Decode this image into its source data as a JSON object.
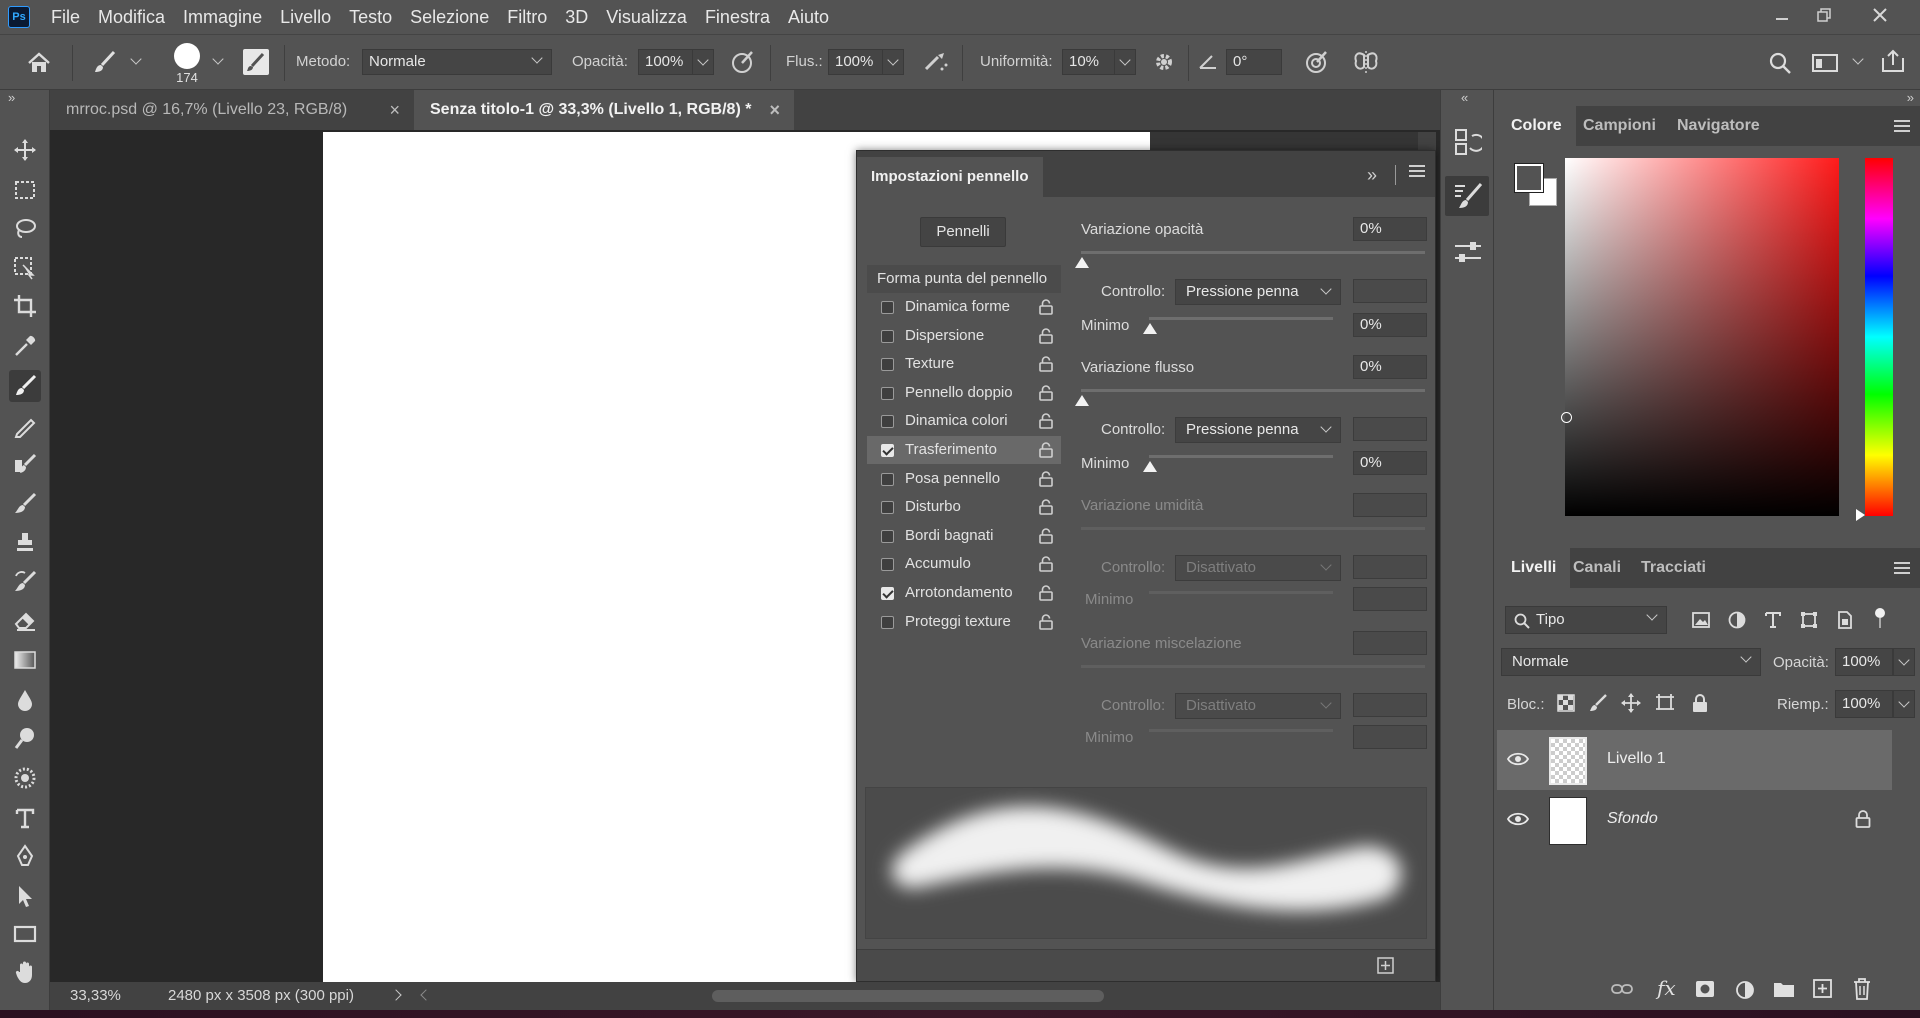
{
  "menubar": {
    "logo": "Ps",
    "items": [
      "File",
      "Modifica",
      "Immagine",
      "Livello",
      "Testo",
      "Selezione",
      "Filtro",
      "3D",
      "Visualizza",
      "Finestra",
      "Aiuto"
    ]
  },
  "options": {
    "brush_size": "174",
    "mode_label": "Metodo:",
    "mode_value": "Normale",
    "opacity_label": "Opacità:",
    "opacity_value": "100%",
    "flow_label": "Flus.:",
    "flow_value": "100%",
    "smoothing_label": "Uniformità:",
    "smoothing_value": "10%",
    "angle_value": "0°"
  },
  "tabs": [
    {
      "label": "mrroc.psd @ 16,7% (Livello 23, RGB/8)",
      "close": "×"
    },
    {
      "label": "Senza titolo-1 @ 33,3% (Livello 1, RGB/8) *",
      "close": "×"
    }
  ],
  "brush_panel": {
    "title": "Impostazioni pennello",
    "brushes_button": "Pennelli",
    "tip_shape": "Forma punta del pennello",
    "items": [
      {
        "label": "Dinamica forme",
        "checked": false
      },
      {
        "label": "Dispersione",
        "checked": false
      },
      {
        "label": "Texture",
        "checked": false
      },
      {
        "label": "Pennello doppio",
        "checked": false
      },
      {
        "label": "Dinamica colori",
        "checked": false
      },
      {
        "label": "Trasferimento",
        "checked": true
      },
      {
        "label": "Posa pennello",
        "checked": false
      },
      {
        "label": "Disturbo",
        "checked": false
      },
      {
        "label": "Bordi bagnati",
        "checked": false
      },
      {
        "label": "Accumulo",
        "checked": false
      },
      {
        "label": "Arrotondamento",
        "checked": true
      },
      {
        "label": "Proteggi texture",
        "checked": false
      }
    ],
    "opacity_jitter_label": "Variazione opacità",
    "opacity_jitter_value": "0%",
    "control_label": "Controllo:",
    "control1_value": "Pressione penna",
    "minimum_label": "Minimo",
    "minimum1_value": "0%",
    "flow_jitter_label": "Variazione flusso",
    "flow_jitter_value": "0%",
    "control2_value": "Pressione penna",
    "minimum2_value": "0%",
    "wet_jitter_label": "Variazione umidità",
    "control3_value": "Disattivato",
    "mix_jitter_label": "Variazione miscelazione",
    "control4_value": "Disattivato"
  },
  "color_panel": {
    "tabs": [
      "Colore",
      "Campioni",
      "Navigatore"
    ]
  },
  "layers_panel": {
    "tabs": [
      "Livelli",
      "Canali",
      "Tracciati"
    ],
    "filter_value": "Tipo",
    "blend_value": "Normale",
    "opacity_label": "Opacità:",
    "opacity_value": "100%",
    "lock_label": "Bloc.:",
    "fill_label": "Riemp.:",
    "fill_value": "100%",
    "layers": [
      {
        "name": "Livello 1"
      },
      {
        "name": "Sfondo"
      }
    ]
  },
  "status": {
    "zoom": "33,33%",
    "doc_info": "2480 px x 3508 px (300 ppi)"
  }
}
